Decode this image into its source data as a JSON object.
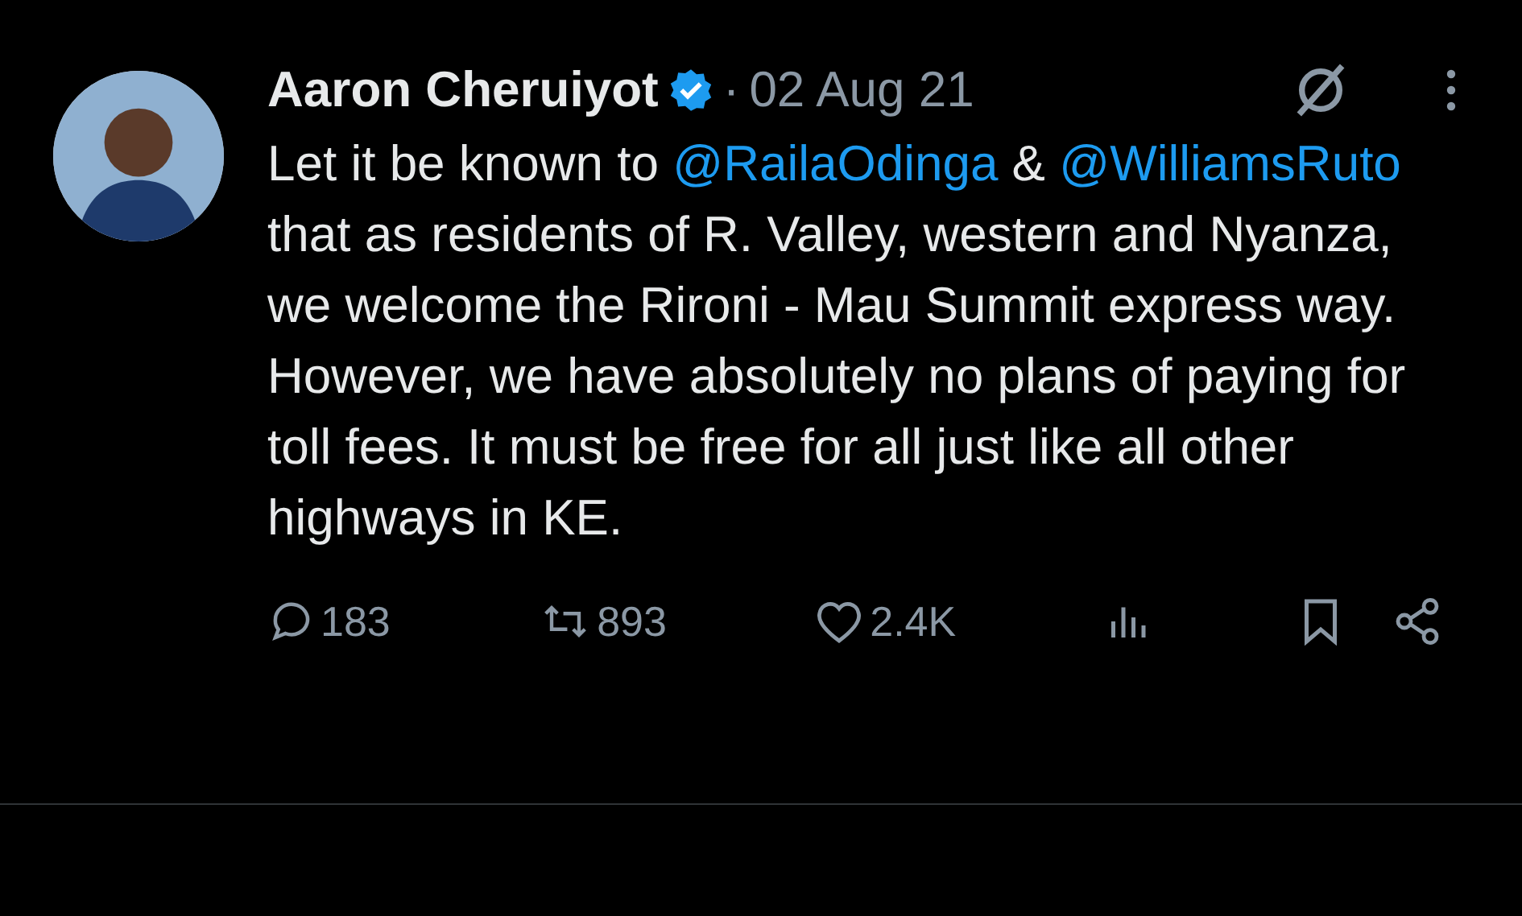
{
  "tweet": {
    "author": "Aaron Cheruiyot",
    "verified": true,
    "separator": "·",
    "date": "02 Aug 21",
    "body": [
      {
        "kind": "text",
        "text": "Let it be known to "
      },
      {
        "kind": "mention",
        "text": "@RailaOdinga"
      },
      {
        "kind": "text",
        "text": " & "
      },
      {
        "kind": "mention",
        "text": "@WilliamsRuto"
      },
      {
        "kind": "text",
        "text": " that as residents of R. Valley, western and Nyanza, we welcome the Rironi - Mau Summit express way. However, we have absolutely no plans of paying for toll fees. It must be free for all just like all other highways in KE."
      }
    ],
    "actions": [
      {
        "kind": "reply",
        "count": "183"
      },
      {
        "kind": "repost",
        "count": "893"
      },
      {
        "kind": "like",
        "count": "2.4K"
      },
      {
        "kind": "views"
      },
      {
        "kind": "bookmark"
      },
      {
        "kind": "share"
      }
    ]
  }
}
